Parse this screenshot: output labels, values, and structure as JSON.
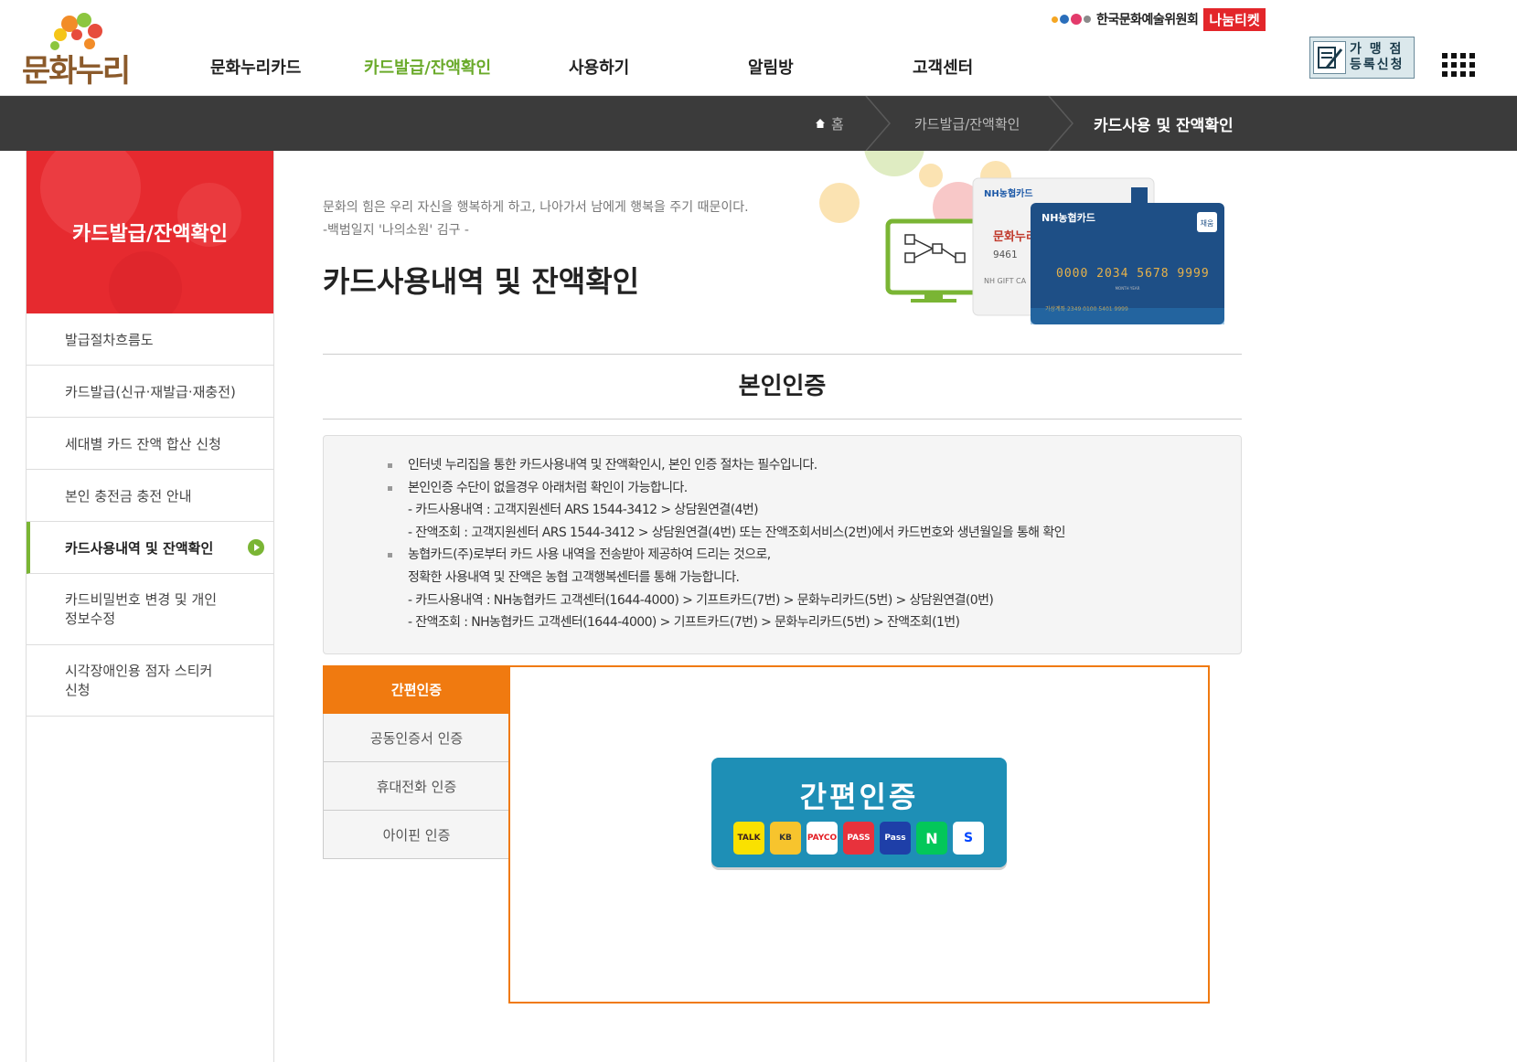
{
  "header": {
    "logo_text": "문화누리",
    "nav": [
      "문화누리카드",
      "카드발급/잔액확인",
      "사용하기",
      "알림방",
      "고객센터"
    ],
    "active_nav": "카드발급/잔액확인",
    "arts_council": "한국문화예술위원회",
    "nanum_ticket": "나눔티켓",
    "register_button": "가 맹 점\n등록신청",
    "register_line1": "가 맹 점",
    "register_line2": "등록신청",
    "allmenu_icon": "grid-icon"
  },
  "breadcrumb": {
    "home": "홈",
    "level1": "카드발급/잔액확인",
    "current": "카드사용 및 잔액확인"
  },
  "sidebar": {
    "title": "카드발급/잔액확인",
    "items": [
      {
        "label": "발급절차흐름도"
      },
      {
        "label": "카드발급(신규·재발급·재충전)"
      },
      {
        "label": "세대별 카드 잔액 합산 신청"
      },
      {
        "label": "본인 충전금 충전 안내"
      },
      {
        "label": "카드사용내역 및 잔액확인"
      },
      {
        "label_line1": "카드비밀번호 변경 및 개인",
        "label_line2": "정보수정"
      },
      {
        "label_line1": "시각장애인용 점자 스티커",
        "label_line2": "신청"
      }
    ],
    "active_index": 4
  },
  "content": {
    "quote_line1": "문화의 힘은 우리 자신을 행복하게 하고, 나아가서 남에게 행복을 주기 때문이다.",
    "quote_line2": "-백범일지 '나의소원' 김구 -",
    "page_title": "카드사용내역 및 잔액확인",
    "card_front_brand": "NH농협카드",
    "card_back_brand": "NH농협카드",
    "card_chip_label": "채움",
    "card_number": "0000  2034  5678  9999",
    "card_valid_label": "MONTH YEAR",
    "card_account": "가상계좌 2349 0100 5401 9999",
    "card_front_logo": "문화누리",
    "card_front_digits": "9461",
    "card_front_sub": "NH GIFT CA",
    "section_title": "본인인증",
    "info": [
      {
        "type": "bullet",
        "text": "인터넷 누리집을 통한 카드사용내역 및 잔액확인시, 본인 인증 절차는 필수입니다."
      },
      {
        "type": "bullet",
        "text": "본인인증 수단이 없을경우 아래처럼 확인이 가능합니다."
      },
      {
        "type": "sub",
        "text": "- 카드사용내역 : 고객지원센터 ARS 1544-3412 > 상담원연결(4번)"
      },
      {
        "type": "sub",
        "text": "- 잔액조회 : 고객지원센터 ARS 1544-3412 > 상담원연결(4번) 또는 잔액조회서비스(2번)에서 카드번호와 생년월일을 통해 확인"
      },
      {
        "type": "bullet",
        "text": "농협카드(주)로부터 카드 사용 내역을 전송받아 제공하여 드리는 것으로,"
      },
      {
        "type": "sub",
        "text": "정확한 사용내역 및 잔액은 농협 고객행복센터를 통해 가능합니다."
      },
      {
        "type": "sub",
        "text": "- 카드사용내역 : NH농협카드 고객센터(1644-4000) > 기프트카드(7번) > 문화누리카드(5번) > 상담원연결(0번)"
      },
      {
        "type": "sub",
        "text": "- 잔액조회 : NH농협카드 고객센터(1644-4000) > 기프트카드(7번) > 문화누리카드(5번) > 잔액조회(1번)"
      }
    ],
    "tabs": [
      "간편인증",
      "공동인증서 인증",
      "휴대전화 인증",
      "아이핀 인증"
    ],
    "active_tab": 0,
    "simple_auth_label": "간편인증",
    "auth_providers": [
      "TALK",
      "KB",
      "PAYCO",
      "PASS",
      "Pass",
      "N",
      "S"
    ]
  },
  "colors": {
    "accent_green": "#7ab534",
    "sidebar_red": "#e62a2f",
    "tab_orange": "#f07a10",
    "auth_blue": "#1e8fb6",
    "locbar": "#3b3b3b"
  }
}
